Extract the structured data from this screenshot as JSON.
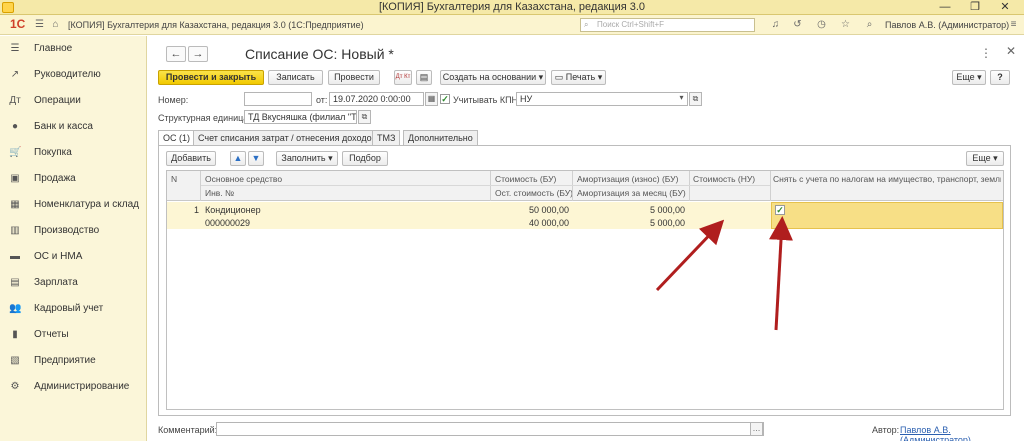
{
  "window": {
    "title": "[КОПИЯ] Бухгалтерия для Казахстана, редакция 3.0",
    "controls": [
      "—",
      "❐",
      "✕"
    ]
  },
  "approw": {
    "logo": "1С",
    "app_name": "[КОПИЯ] Бухгалтерия для Казахстана, редакция 3.0  (1С:Предприятие)",
    "search_placeholder": "Поиск Ctrl+Shift+F",
    "user": "Павлов А.В. (Администратор)"
  },
  "sidebar": {
    "items": [
      {
        "label": "Главное",
        "icon": "menu-icon",
        "glyph": "☰"
      },
      {
        "label": "Руководителю",
        "icon": "chart-icon",
        "glyph": "↗"
      },
      {
        "label": "Операции",
        "icon": "operations-icon",
        "glyph": "Дт"
      },
      {
        "label": "Банк и касса",
        "icon": "bank-icon",
        "glyph": "●"
      },
      {
        "label": "Покупка",
        "icon": "cart-icon",
        "glyph": "🛒"
      },
      {
        "label": "Продажа",
        "icon": "bag-icon",
        "glyph": "▣"
      },
      {
        "label": "Номенклатура и склад",
        "icon": "warehouse-icon",
        "glyph": "▦"
      },
      {
        "label": "Производство",
        "icon": "production-icon",
        "glyph": "▥"
      },
      {
        "label": "ОС и НМА",
        "icon": "truck-icon",
        "glyph": "▬"
      },
      {
        "label": "Зарплата",
        "icon": "salary-icon",
        "glyph": "▤"
      },
      {
        "label": "Кадровый учет",
        "icon": "people-icon",
        "glyph": "👥"
      },
      {
        "label": "Отчеты",
        "icon": "reports-icon",
        "glyph": "▮"
      },
      {
        "label": "Предприятие",
        "icon": "enterprise-icon",
        "glyph": "▧"
      },
      {
        "label": "Администрирование",
        "icon": "gear-icon",
        "glyph": "⚙"
      }
    ]
  },
  "form": {
    "title": "Списание ОС: Новый *",
    "more": "⋮",
    "close": "✕",
    "toolbar": {
      "post_close": "Провести и закрыть",
      "save": "Записать",
      "post": "Провести",
      "dt_kt": "Дт Кт",
      "create_based": "Создать на основании",
      "print": "Печать",
      "more": "Еще",
      "help": "?"
    },
    "fields": {
      "number_label": "Номер:",
      "number_value": "",
      "date_label": "от:",
      "date_value": "19.07.2020  0:00:00",
      "kpn_label": "Учитывать КПН",
      "kpn_checked": "✓",
      "nu_value": "НУ",
      "struct_label": "Структурная единица:",
      "struct_value": "ТД Вкусняшка (филиал \"ТД Пакомк"
    },
    "tabs": [
      "ОС (1)",
      "Счет списания затрат / отнесения доходов",
      "ТМЗ",
      "Дополнительно"
    ],
    "table_toolbar": {
      "add": "Добавить",
      "fill": "Заполнить",
      "select": "Подбор",
      "more": "Еще"
    },
    "table": {
      "headers": {
        "n": "N",
        "asset": "Основное средство",
        "inv": "Инв. №",
        "cost_bu": "Стоимость (БУ)",
        "resid_bu": "Ост. стоимость (БУ)",
        "amort_bu": "Амортизация (износ) (БУ)",
        "amort_month": "Амортизация за месяц (БУ)",
        "cost_nu": "Стоимость (НУ)",
        "deregister": "Снять с учета по налогам на имущество, транспорт, землю"
      },
      "rows": [
        {
          "n": "1",
          "asset": "Кондиционер",
          "inv": "000000029",
          "cost_bu": "50 000,00",
          "resid_bu": "40 000,00",
          "amort_bu": "5 000,00",
          "amort_month": "5 000,00",
          "cost_nu": "",
          "deregister": "✓"
        }
      ]
    },
    "footer": {
      "comment_label": "Комментарий:",
      "comment_value": "",
      "author_label": "Автор:",
      "author_value": "Павлов А.В. (Администратор)"
    }
  }
}
